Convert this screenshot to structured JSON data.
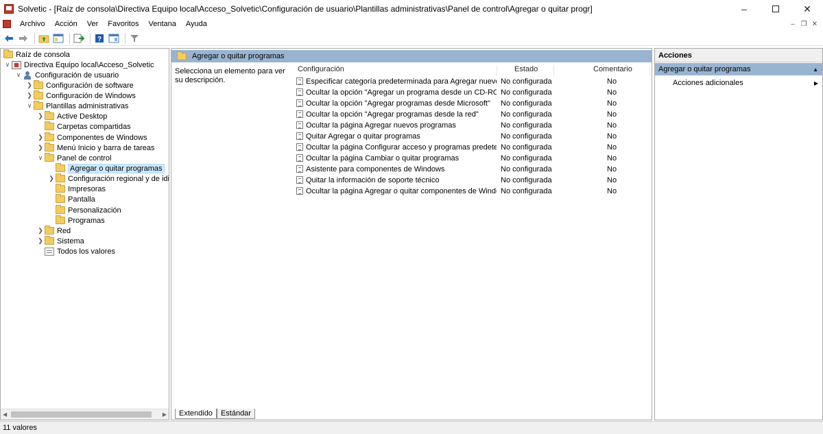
{
  "window": {
    "title": "Solvetic - [Raíz de consola\\Directiva Equipo local\\Acceso_Solvetic\\Configuración de usuario\\Plantillas administrativas\\Panel de control\\Agregar o quitar progr]",
    "controls": [
      "minimize-icon",
      "maximize-icon",
      "close-icon"
    ]
  },
  "menu": {
    "items": [
      "Archivo",
      "Acción",
      "Ver",
      "Favoritos",
      "Ventana",
      "Ayuda"
    ]
  },
  "toolbar": {
    "icons": [
      "back-arrow-icon",
      "forward-arrow-icon",
      "up-folder-icon",
      "show-hide-tree-icon",
      "export-list-icon",
      "help-icon",
      "properties-icon",
      "filter-icon"
    ]
  },
  "tree": {
    "items": [
      {
        "label": "Raíz de consola",
        "icon": "folder"
      },
      {
        "label": "Directiva Equipo local\\Acceso_Solvetic",
        "icon": "policy"
      },
      {
        "label": "Configuración de usuario",
        "icon": "user"
      },
      {
        "label": "Configuración de software",
        "icon": "folder"
      },
      {
        "label": "Configuración de Windows",
        "icon": "folder"
      },
      {
        "label": "Plantillas administrativas",
        "icon": "folder"
      },
      {
        "label": "Active Desktop",
        "icon": "folder"
      },
      {
        "label": "Carpetas compartidas",
        "icon": "folder"
      },
      {
        "label": "Componentes de Windows",
        "icon": "folder"
      },
      {
        "label": "Menú Inicio y barra de tareas",
        "icon": "folder"
      },
      {
        "label": "Panel de control",
        "icon": "folder"
      },
      {
        "label": "Agregar o quitar programas",
        "icon": "folder",
        "selected": true
      },
      {
        "label": "Configuración regional y de idio",
        "icon": "folder"
      },
      {
        "label": "Impresoras",
        "icon": "folder"
      },
      {
        "label": "Pantalla",
        "icon": "folder"
      },
      {
        "label": "Personalización",
        "icon": "folder"
      },
      {
        "label": "Programas",
        "icon": "folder"
      },
      {
        "label": "Red",
        "icon": "folder"
      },
      {
        "label": "Sistema",
        "icon": "folder"
      },
      {
        "label": "Todos los valores",
        "icon": "settings"
      }
    ]
  },
  "main": {
    "header": "Agregar o quitar programas",
    "description": "Selecciona un elemento para ver su descripción.",
    "columns": [
      "Configuración",
      "Estado",
      "Comentario"
    ],
    "rows": [
      {
        "setting": "Especificar categoría predeterminada para Agregar nuevos p...",
        "state": "No configurada",
        "comment": "No"
      },
      {
        "setting": "Ocultar la opción \"Agregar un programa desde un CD-ROM...",
        "state": "No configurada",
        "comment": "No"
      },
      {
        "setting": "Ocultar la opción \"Agregar programas desde Microsoft\"",
        "state": "No configurada",
        "comment": "No"
      },
      {
        "setting": "Ocultar la opción \"Agregar programas desde la red\"",
        "state": "No configurada",
        "comment": "No"
      },
      {
        "setting": "Ocultar la página Agregar nuevos programas",
        "state": "No configurada",
        "comment": "No"
      },
      {
        "setting": "Quitar Agregar o quitar programas",
        "state": "No configurada",
        "comment": "No"
      },
      {
        "setting": "Ocultar la página Configurar acceso y programas predeterm...",
        "state": "No configurada",
        "comment": "No"
      },
      {
        "setting": "Ocultar la página Cambiar o quitar programas",
        "state": "No configurada",
        "comment": "No"
      },
      {
        "setting": "Asistente para componentes de Windows",
        "state": "No configurada",
        "comment": "No"
      },
      {
        "setting": "Quitar la información de soporte técnico",
        "state": "No configurada",
        "comment": "No"
      },
      {
        "setting": "Ocultar la página Agregar o quitar componentes de Windows",
        "state": "No configurada",
        "comment": "No"
      }
    ],
    "tabs": [
      "Extendido",
      "Estándar"
    ]
  },
  "actions": {
    "title": "Acciones",
    "section": "Agregar o quitar programas",
    "item": "Acciones adicionales"
  },
  "status": {
    "text": "11 valores"
  },
  "colors": {
    "header_bg": "#99b4d1",
    "selection_bg": "#cce8ff",
    "folder": "#f2cc61"
  }
}
